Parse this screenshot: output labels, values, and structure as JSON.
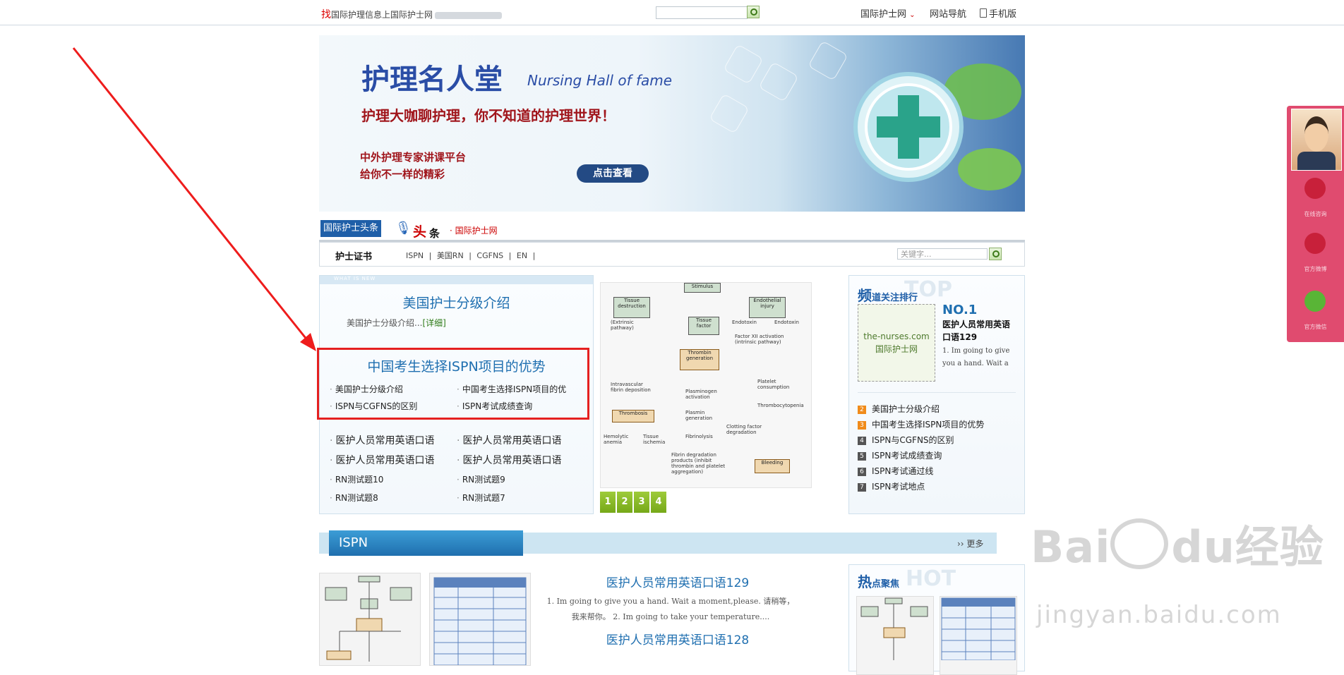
{
  "topbar": {
    "find": "找",
    "tagline": "国际护理信息上国际护士网",
    "search_value": "",
    "nav": [
      {
        "label": "国际护士网",
        "caret": "⌄"
      },
      {
        "label": "网站导航"
      },
      {
        "label": "手机版"
      }
    ]
  },
  "banner": {
    "title": "护理名人堂",
    "subtitle": "Nursing Hall of fame",
    "slogan": "护理大咖聊护理，你不知道的护理世界！",
    "line1": "中外护理专家讲课平台",
    "line2": "给你不一样的精彩",
    "button": "点击查看"
  },
  "headline": {
    "tag": "国际护士头条",
    "big": "头",
    "small": "条",
    "site": "· 国际护士网"
  },
  "subnav": {
    "label": "护士证书",
    "links": [
      "ISPN",
      "|",
      "美国RN",
      "|",
      "CGFNS",
      "|",
      "EN",
      "|"
    ],
    "search_placeholder": "关键字..."
  },
  "feature": {
    "caption": "WHAT IS NEW",
    "title1": "美国护士分级介绍",
    "desc": "美国护士分级介绍...",
    "detail": "[详细]",
    "title2": "中国考生选择ISPN项目的优势",
    "links_small": [
      "美国护士分级介绍",
      "中国考生选择ISPN项目的优",
      "ISPN与CGFNS的区别",
      "ISPN考试成绩查询"
    ],
    "links_big": [
      "医护人员常用英语口语",
      "医护人员常用英语口语",
      "医护人员常用英语口语",
      "医护人员常用英语口语",
      "RN测试题10",
      "RN测试题9",
      "RN测试题8",
      "RN测试题7"
    ]
  },
  "slideshow": {
    "pages": [
      "1",
      "2",
      "3",
      "4"
    ],
    "flow_labels": {
      "a": "Stimulus",
      "b": "Tissue destruction",
      "c": "(Extrinsic pathway)",
      "d": "Tissue factor",
      "e": "Endothelial injury",
      "f": "Endotoxin",
      "g": "Endotoxin",
      "h": "Factor XII activation (intrinsic pathway)",
      "i": "Thrombin generation",
      "j": "Intravascular fibrin deposition",
      "k": "Plasminogen activation",
      "l": "Platelet consumption",
      "m": "Thrombocytopenia",
      "n": "Thrombosis",
      "o": "Plasmin generation",
      "p": "Fibrinolysis",
      "q": "Clotting factor degradation",
      "r": "Hemolytic anemia",
      "s": "Tissue ischemia",
      "t": "Fibrin degradation products (inhibit thrombin and platelet aggregation)",
      "u": "Bleeding"
    }
  },
  "ranking": {
    "head_big": "频",
    "head_small": "道关注排行",
    "top_watermark": "TOP",
    "thumb_site": "the-nurses.com",
    "thumb_name": "国际护士网",
    "no1": "NO.1",
    "no1_title": "医护人员常用英语口语129",
    "no1_desc": "1. Im going to give you a hand. Wait a",
    "items": [
      {
        "n": "2",
        "label": "美国护士分级介绍"
      },
      {
        "n": "3",
        "label": "中国考生选择ISPN项目的优势"
      },
      {
        "n": "4",
        "label": "ISPN与CGFNS的区别"
      },
      {
        "n": "5",
        "label": "ISPN考试成绩查询"
      },
      {
        "n": "6",
        "label": "ISPN考试通过线"
      },
      {
        "n": "7",
        "label": "ISPN考试地点"
      }
    ]
  },
  "ispn": {
    "tab": "ISPN",
    "more": "更多",
    "article1_title": "医护人员常用英语口语129",
    "article1_desc": "1. Im going to give you a hand. Wait a moment,please. 请稍等，我来帮你。 2. Im going to take your temperature....",
    "article2_title": "医护人员常用英语口语128"
  },
  "hot": {
    "head_big": "热",
    "head_small": "点聚焦",
    "watermark": "HOT"
  },
  "side_widget": {
    "labels": [
      "在线咨询",
      "官方微博",
      "官方微信"
    ]
  },
  "watermark": {
    "brand": "Bai",
    "du": "du",
    "cn": "经验",
    "url": "jingyan.baidu.com"
  },
  "colors": {
    "accent": "#1f6fb0",
    "highlight_border": "#e52020",
    "arrow": "#ee1c1c",
    "side_widget": "#e04b6f"
  }
}
